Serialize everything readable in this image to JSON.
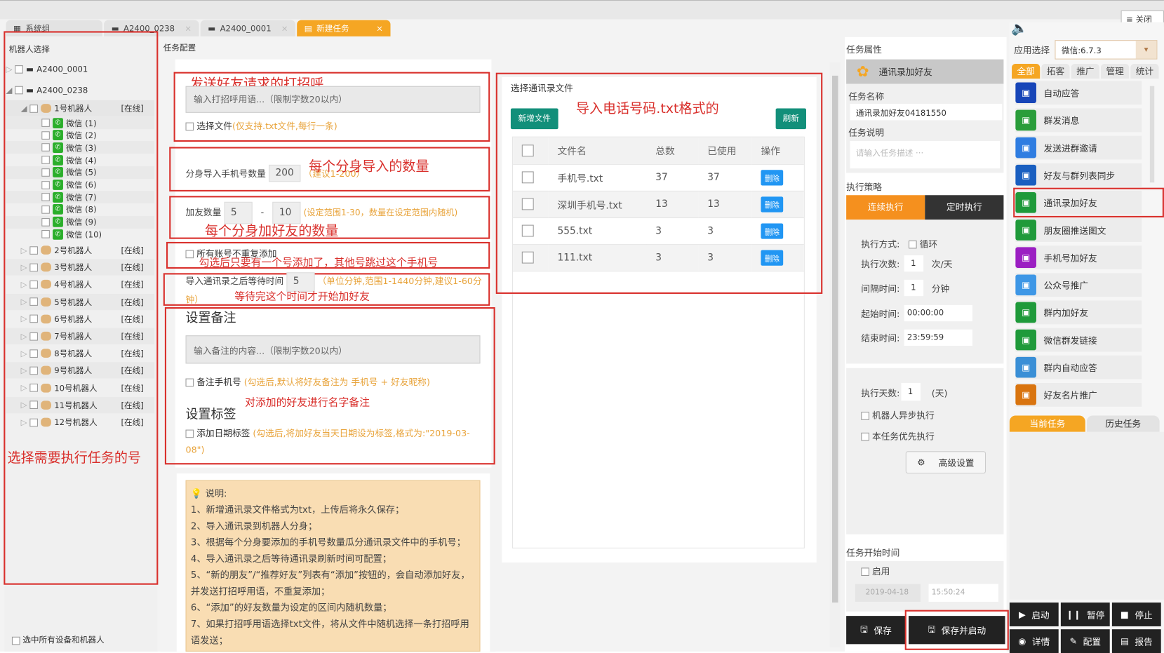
{
  "tabs": [
    {
      "label": "系统组",
      "icon": "grid-icon"
    },
    {
      "label": "A2400_0238",
      "icon": "device-icon"
    },
    {
      "label": "A2400_0001",
      "icon": "device-icon"
    },
    {
      "label": "新建任务",
      "icon": "task-icon",
      "active": true
    }
  ],
  "close_all": "关闭全",
  "left": {
    "title": "机器人选择",
    "devices": [
      "A2400_0001",
      "A2400_0238"
    ],
    "robot1": {
      "label": "1号机器人",
      "status": "[在线]"
    },
    "wechats": [
      "微信 (1)",
      "微信 (2)",
      "微信 (3)",
      "微信 (4)",
      "微信 (5)",
      "微信 (6)",
      "微信 (7)",
      "微信 (8)",
      "微信 (9)",
      "微信 (10)"
    ],
    "robots": [
      {
        "label": "2号机器人",
        "status": "[在线]"
      },
      {
        "label": "3号机器人",
        "status": "[在线]"
      },
      {
        "label": "4号机器人",
        "status": "[在线]"
      },
      {
        "label": "5号机器人",
        "status": "[在线]"
      },
      {
        "label": "6号机器人",
        "status": "[在线]"
      },
      {
        "label": "7号机器人",
        "status": "[在线]"
      },
      {
        "label": "8号机器人",
        "status": "[在线]"
      },
      {
        "label": "9号机器人",
        "status": "[在线]"
      },
      {
        "label": "10号机器人",
        "status": "[在线]"
      },
      {
        "label": "11号机器人",
        "status": "[在线]"
      },
      {
        "label": "12号机器人",
        "status": "[在线]"
      }
    ],
    "select_all": "选中所有设备和机器人"
  },
  "config": {
    "title": "任务配置",
    "greeting_placeholder": "输入打招呼用语...（限制字数20以内）",
    "select_file": "选择文件",
    "select_file_hint": "(仅支持.txt文件,每行一条)",
    "import_count_label": "分身导入手机号数量",
    "import_count": "200",
    "import_count_hint": "（建议1-200）",
    "add_count_label": "加友数量",
    "add_min": "5",
    "add_sep": "-",
    "add_max": "10",
    "add_hint": "(设定范围1-30，数量在设定范围内随机)",
    "no_repeat": "所有账号不重复添加",
    "wait_label": "导入通讯录之后等待时间",
    "wait_value": "5",
    "wait_hint": "（单位分钟,范围1-1440分钟,建议1-60分钟）",
    "remark_title": "设置备注",
    "remark_placeholder": "输入备注的内容...（限制字数20以内）",
    "remark_phone": "备注手机号",
    "remark_phone_hint": "(勾选后,默认将好友备注为 手机号 + 好友昵称)",
    "tag_title": "设置标签",
    "date_tag": "添加日期标签",
    "date_tag_hint": "(勾选后,将加好友当天日期设为标签,格式为:\"2019-03-08\")",
    "notes_title": "说明:",
    "notes": [
      "1、新增通讯录文件格式为txt，上传后将永久保存；",
      "2、导入通讯录到机器人分身；",
      "3、根据每个分身要添加的手机号数量瓜分通讯录文件中的手机号；",
      "4、导入通讯录之后等待通讯录刷新时间可配置；",
      "5、“新的朋友”/“推荐好友”列表有“添加”按钮的，会自动添加好友，并发送打招呼用语，不重复添加；",
      "6、“添加”的好友数量为设定的区间内随机数量；",
      "7、如果打招呼用语选择txt文件，将从文件中随机选择一条打招呼用语发送；"
    ]
  },
  "annotations": {
    "greeting": "发送好友请求的打招呼",
    "import_count": "每个分身导入的数量",
    "add_count": "每个分身加好友的数量",
    "no_repeat": "勾选后只要有一个号添加了，其他号跳过这个手机号",
    "wait": "等待完这个时间才开始加好友",
    "remark": "对添加的好友进行名字备注",
    "files": "导入电话号码.txt格式的",
    "select": "选择需要执行任务的号"
  },
  "files": {
    "title": "选择通讯录文件",
    "add_button": "新增文件",
    "refresh_button": "刷新",
    "headers": [
      "文件名",
      "总数",
      "已使用",
      "操作"
    ],
    "rows": [
      {
        "name": "手机号.txt",
        "total": "37",
        "used": "37",
        "action": "删除"
      },
      {
        "name": "深圳手机号.txt",
        "total": "13",
        "used": "13",
        "action": "删除"
      },
      {
        "name": "555.txt",
        "total": "3",
        "used": "3",
        "action": "删除"
      },
      {
        "name": "111.txt",
        "total": "3",
        "used": "3",
        "action": "删除"
      }
    ]
  },
  "task": {
    "props_title": "任务属性",
    "type": "通讯录加好友",
    "name_label": "任务名称",
    "name_value": "通讯录加好友04181550",
    "desc_label": "任务说明",
    "desc_placeholder": "请输入任务描述 ···",
    "strategy_title": "执行策略",
    "tab_continuous": "连续执行",
    "tab_scheduled": "定时执行",
    "mode_label": "执行方式:",
    "loop": "循环",
    "times_label": "执行次数:",
    "times": "1",
    "times_unit": "次/天",
    "interval_label": "间隔时间:",
    "interval": "1",
    "interval_unit": "分钟",
    "start_label": "起始时间:",
    "start": "00:00:00",
    "end_label": "结束时间:",
    "end": "23:59:59",
    "days_label": "执行天数:",
    "days": "1",
    "days_unit": "(天)",
    "async": "机器人异步执行",
    "priority": "本任务优先执行",
    "advanced": "高级设置",
    "start_time_title": "任务开始时间",
    "enable": "启用",
    "date": "2019-04-18",
    "time": "15:50:24",
    "save": "保存",
    "save_start": "保存并启动"
  },
  "apps": {
    "select_label": "应用选择",
    "select_value": "微信:6.7.3",
    "categories": [
      "全部",
      "拓客",
      "推广",
      "管理",
      "统计"
    ],
    "items": [
      {
        "label": "自动应答",
        "color": "#1846b8"
      },
      {
        "label": "群发消息",
        "color": "#2a9d3a"
      },
      {
        "label": "发送进群邀请",
        "color": "#2f7de1"
      },
      {
        "label": "好友与群列表同步",
        "color": "#1a5fc0"
      },
      {
        "label": "通讯录加好友",
        "color": "#1f9a3a"
      },
      {
        "label": "朋友圈推送图文",
        "color": "#1f9a3a"
      },
      {
        "label": "手机号加好友",
        "color": "#9b1fc2"
      },
      {
        "label": "公众号推广",
        "color": "#3e97e6"
      },
      {
        "label": "群内加好友",
        "color": "#1f9a3a"
      },
      {
        "label": "微信群发链接",
        "color": "#1f9a3a"
      },
      {
        "label": "群内自动应答",
        "color": "#3a8fd6"
      },
      {
        "label": "好友名片推广",
        "color": "#d9740f"
      }
    ],
    "current_tasks": "当前任务",
    "history_tasks": "历史任务",
    "actions": [
      "启动",
      "暂停",
      "停止",
      "详情",
      "配置",
      "报告"
    ]
  },
  "colors": {
    "accent": "#f5a623",
    "annotation": "#d9302c",
    "teal": "#128f7a",
    "delete": "#2196f3"
  }
}
